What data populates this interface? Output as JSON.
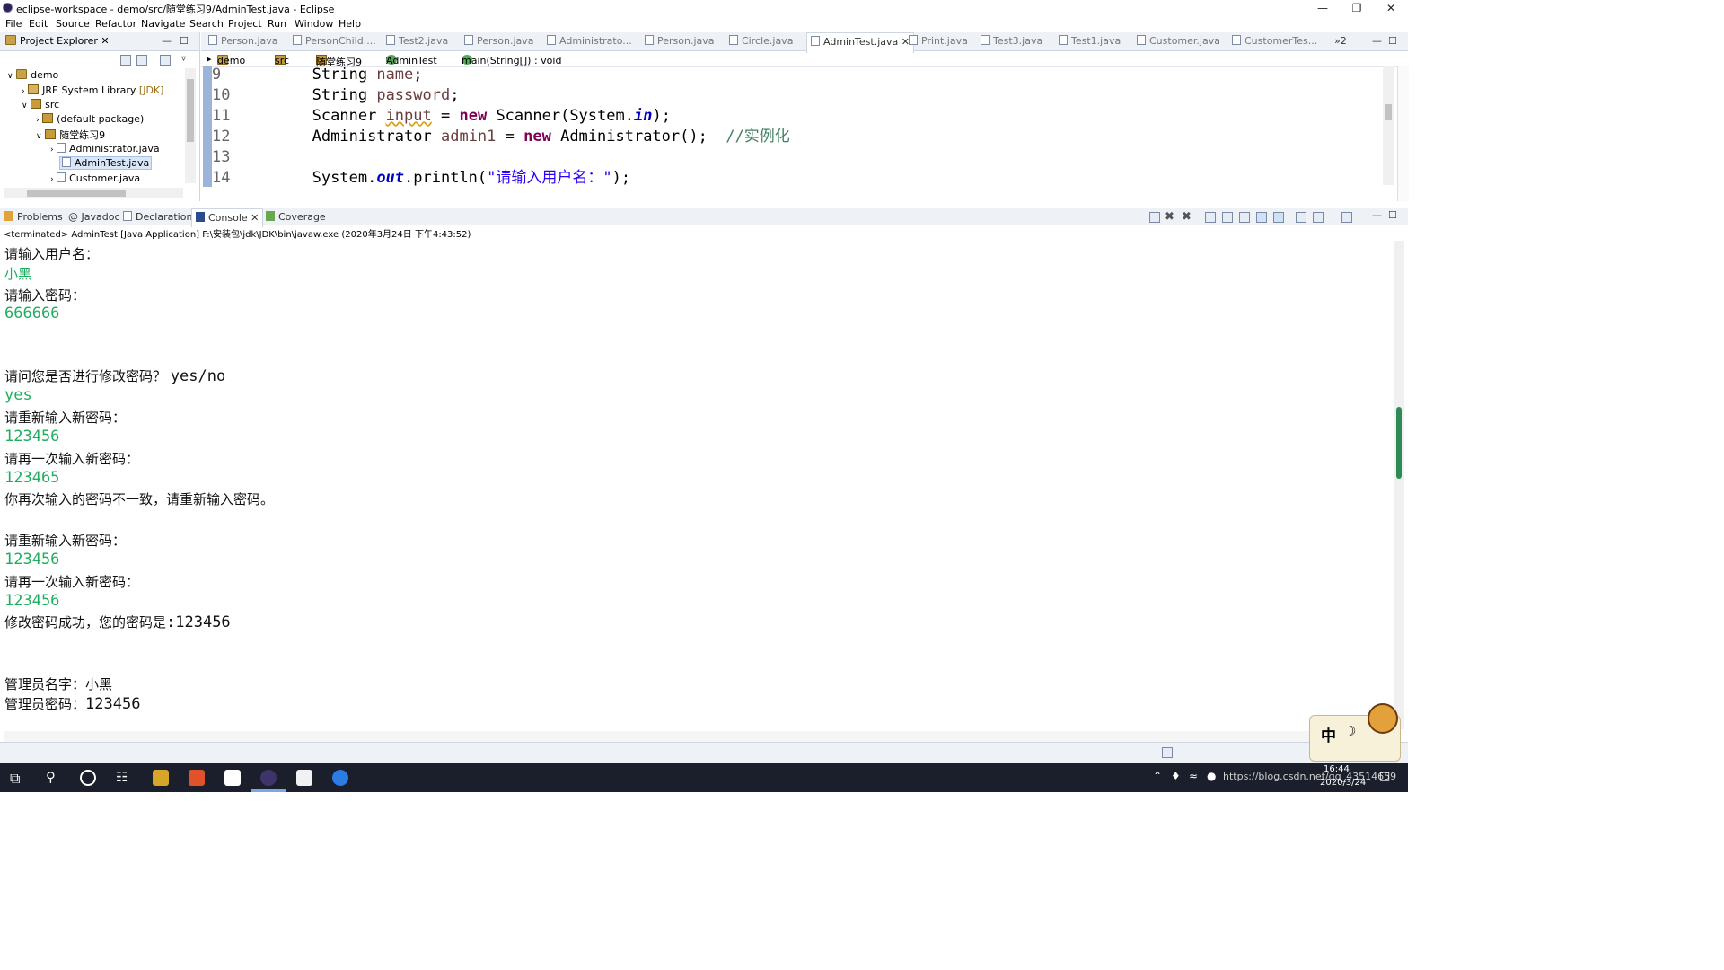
{
  "window": {
    "title": "eclipse-workspace - demo/src/随堂练习9/AdminTest.java - Eclipse"
  },
  "menu": [
    "File",
    "Edit",
    "Source",
    "Refactor",
    "Navigate",
    "Search",
    "Project",
    "Run",
    "Window",
    "Help"
  ],
  "project_explorer": {
    "tab": "Project Explorer",
    "tree": [
      {
        "label": "demo"
      },
      {
        "label": "JRE System Library",
        "suffix": "[JDK]"
      },
      {
        "label": "src"
      },
      {
        "label": "(default package)"
      },
      {
        "label": "随堂练习9"
      },
      {
        "label": "Administrator.java"
      },
      {
        "label": "AdminTest.java"
      },
      {
        "label": "Customer.java"
      }
    ]
  },
  "editor": {
    "tabs": [
      "Person.java",
      "PersonChild....",
      "Test2.java",
      "Person.java",
      "Administrato...",
      "Person.java",
      "Circle.java",
      "AdminTest.java",
      "Print.java",
      "Test3.java",
      "Test1.java",
      "Customer.java",
      "CustomerTes..."
    ],
    "more_tabs": "»2",
    "breadcrumb": [
      "demo",
      "src",
      "随堂练习9",
      "AdminTest",
      "main(String[]) : void"
    ],
    "lines": [
      {
        "num": "9"
      },
      {
        "num": "10"
      },
      {
        "num": "11"
      },
      {
        "num": "12"
      },
      {
        "num": "13"
      },
      {
        "num": "14"
      }
    ],
    "code": {
      "l9_type": "String",
      "l9_var": "name",
      "l10_type": "String",
      "l10_var": "password",
      "l11_type": "Scanner",
      "l11_var": "input",
      "l11_new": "new",
      "l11_cls": "Scanner(System.",
      "l11_fld": "in",
      "l11_end": ");",
      "l12_type": "Administrator",
      "l12_var": "admin1",
      "l12_new": "new",
      "l12_cls": "Administrator();",
      "l12_cmt": "//实例化",
      "l14_a": "System.",
      "l14_fld": "out",
      "l14_b": ".println(",
      "l14_str": "\"请输入用户名：\"",
      "l14_end": ");"
    }
  },
  "console_tabs": [
    "Problems",
    "Javadoc",
    "Declaration",
    "Console",
    "Coverage"
  ],
  "console": {
    "header": "<terminated> AdminTest [Java Application] F:\\安装包\\jdk\\JDK\\bin\\javaw.exe (2020年3月24日 下午4:43:52)",
    "lines": [
      {
        "text": "请输入用户名："
      },
      {
        "text": "小黑"
      },
      {
        "text": "请输入密码："
      },
      {
        "text": "666666"
      },
      {
        "text": "请问您是否进行修改密码？",
        "tail": "yes/no"
      },
      {
        "text": "yes"
      },
      {
        "text": "请重新输入新密码："
      },
      {
        "text": "123456"
      },
      {
        "text": "请再一次输入新密码："
      },
      {
        "text": "123465"
      },
      {
        "text": "你再次输入的密码不一致，请重新输入密码。"
      },
      {
        "text": "请重新输入新密码："
      },
      {
        "text": "123456"
      },
      {
        "text": "请再一次输入新密码："
      },
      {
        "text": "123456"
      },
      {
        "text": "修改密码成功，您的密码是",
        "tail": ":123456"
      },
      {
        "text": "管理员名字：小黑"
      },
      {
        "text": "管理员密码：",
        "tail": "123456"
      }
    ]
  },
  "taskbar": {
    "time": "16:44",
    "date": "2020/3/24",
    "watermark": "https://blog.csdn.net/qq_43514659",
    "ime_glyphs": [
      "中",
      "☽"
    ]
  },
  "colors": {
    "input_text": "#1fae5e",
    "keyword": "#7f0055",
    "string": "#2a00ff",
    "comment": "#3f7f5f"
  }
}
